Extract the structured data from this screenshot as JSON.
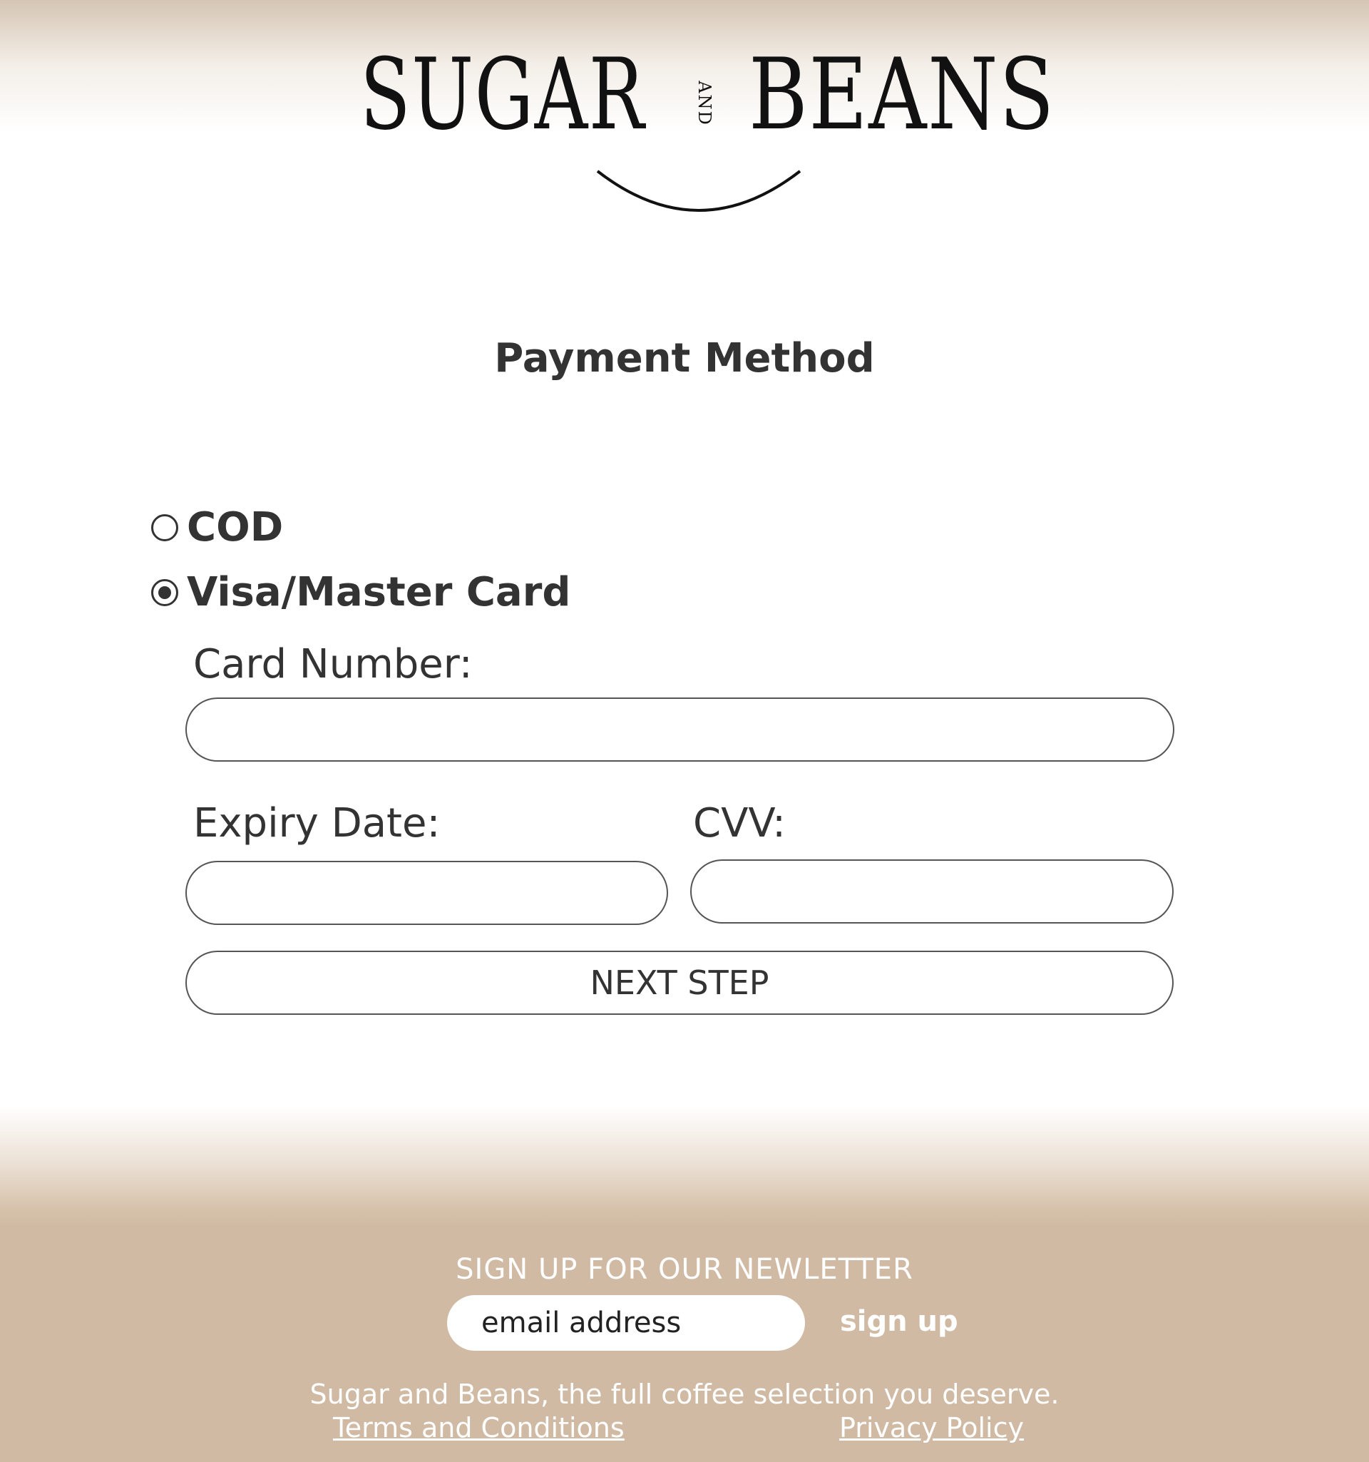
{
  "brand": {
    "word1": "SUGAR",
    "and": "AND",
    "word2": "BEANS"
  },
  "page": {
    "title": "Payment Method"
  },
  "payment": {
    "options": [
      {
        "label": "COD",
        "selected": false
      },
      {
        "label": "Visa/Master Card",
        "selected": true
      }
    ],
    "card_number_label": "Card Number:",
    "card_number_value": "",
    "expiry_label": "Expiry Date:",
    "expiry_value": "",
    "cvv_label": "CVV:",
    "cvv_value": "",
    "next_button": "NEXT STEP"
  },
  "footer": {
    "newsletter_title": "SIGN UP FOR OUR NEWLETTER",
    "email_placeholder": "email address",
    "email_value": "",
    "signup_button": "sign up",
    "tagline": "Sugar and Beans, the full coffee selection you deserve.",
    "terms_link": "Terms and Conditions",
    "privacy_link": "Privacy Policy"
  },
  "colors": {
    "text": "#333333",
    "footer_background": "#d0baa3",
    "footer_text": "#ffffff"
  }
}
